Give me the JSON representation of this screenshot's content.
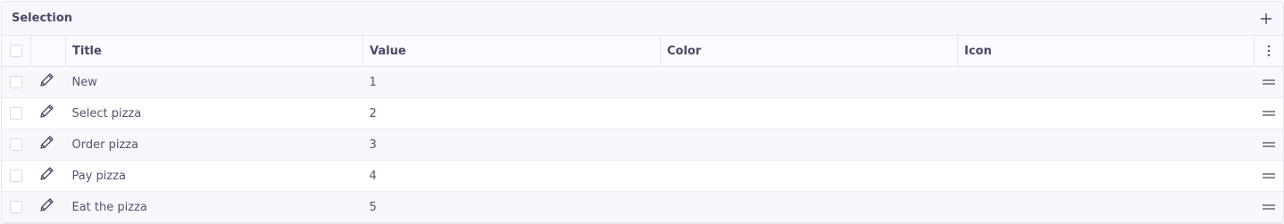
{
  "panel": {
    "title": "Selection",
    "add_icon": "plus-icon"
  },
  "columns": {
    "title": "Title",
    "value": "Value",
    "color": "Color",
    "icon": "Icon",
    "menu_icon": "vertical-dots-icon"
  },
  "rows": [
    {
      "title": "New",
      "value": "1",
      "color": "",
      "icon": ""
    },
    {
      "title": "Select pizza",
      "value": "2",
      "color": "",
      "icon": ""
    },
    {
      "title": "Order pizza",
      "value": "3",
      "color": "",
      "icon": ""
    },
    {
      "title": "Pay pizza",
      "value": "4",
      "color": "",
      "icon": ""
    },
    {
      "title": "Eat the pizza",
      "value": "5",
      "color": "",
      "icon": ""
    }
  ],
  "row_icons": {
    "edit": "pencil-icon",
    "drag": "drag-handle-icon"
  }
}
